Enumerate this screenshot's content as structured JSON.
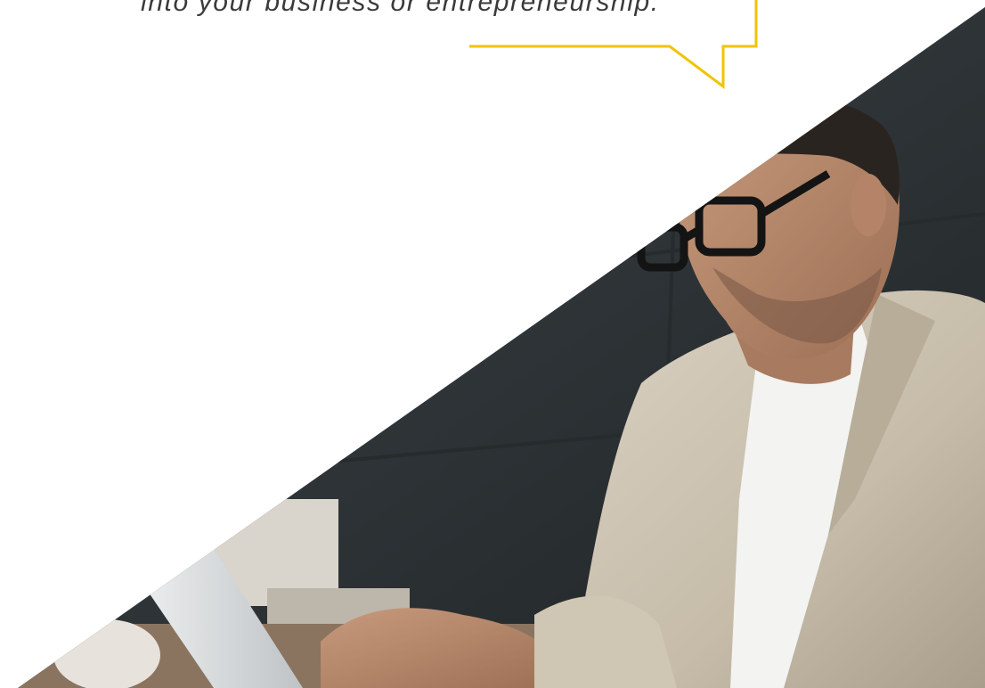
{
  "quote": {
    "text": "into your business or entrepreneurship."
  },
  "colors": {
    "accent": "#f2c300",
    "quote_text": "#3a3a3a",
    "background": "#ffffff"
  },
  "photo": {
    "subject": "man-in-glasses-working-at-laptop"
  }
}
